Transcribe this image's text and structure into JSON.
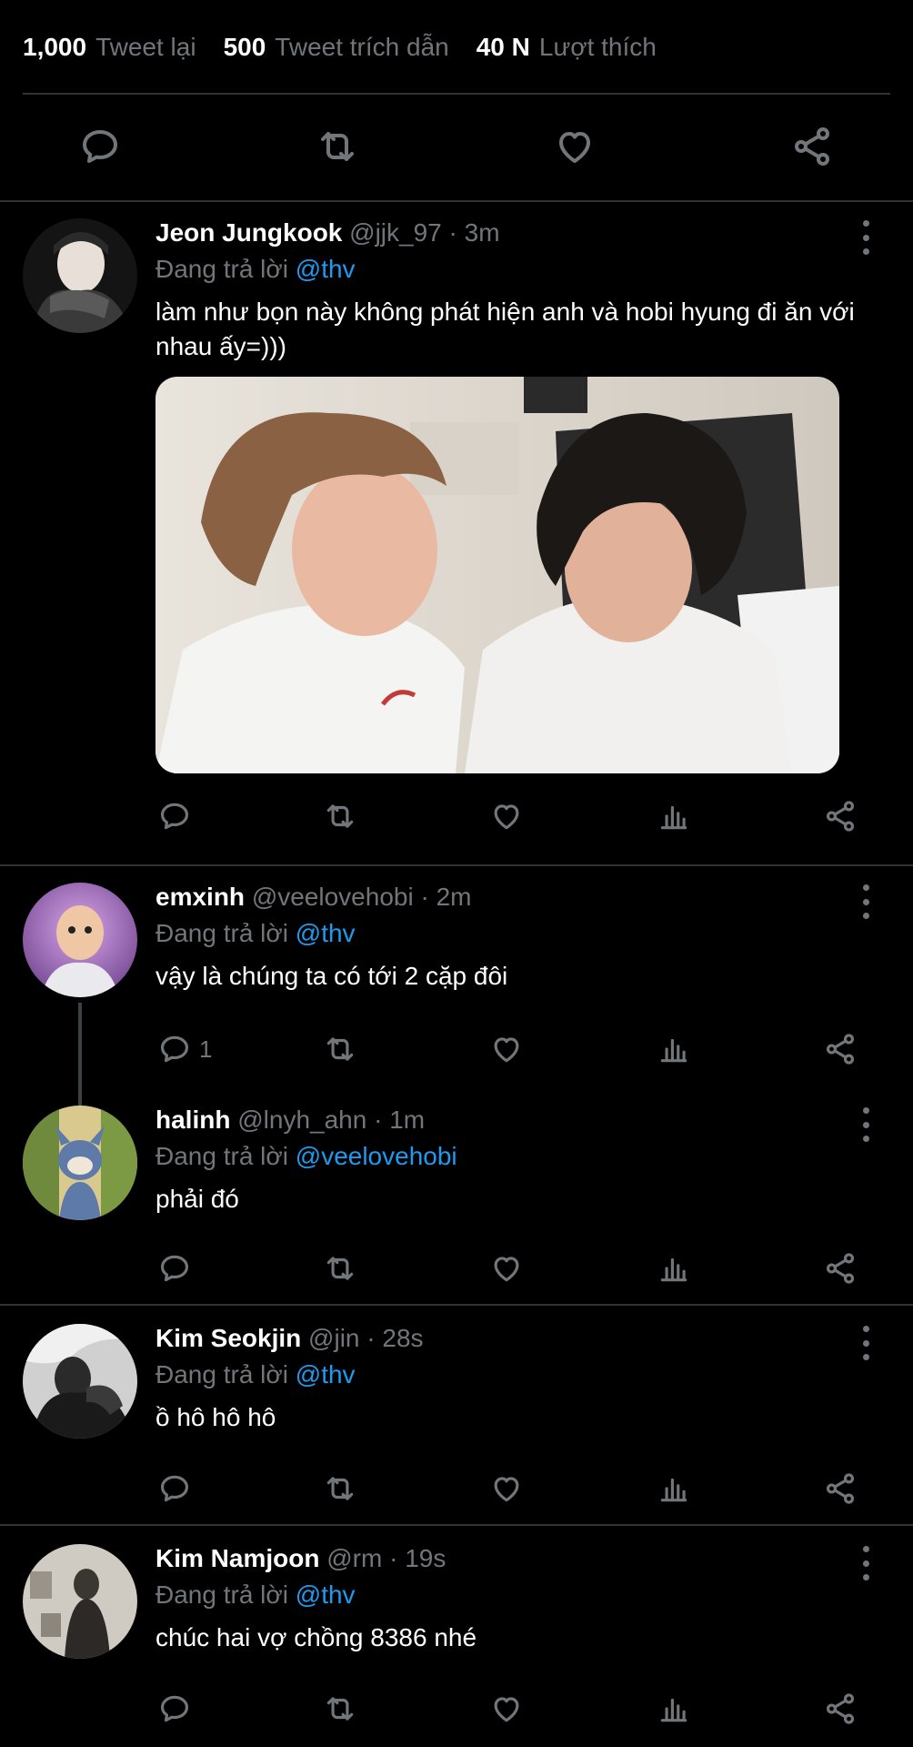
{
  "stats": [
    {
      "number": "1,000",
      "label": "Tweet lại"
    },
    {
      "number": "500",
      "label": "Tweet trích dẫn"
    },
    {
      "number": "40 N",
      "label": "Lượt thích"
    }
  ],
  "main_actions": [
    "reply-icon",
    "retweet-icon",
    "like-icon",
    "share-icon"
  ],
  "reply_prefix": "Đang trả lời",
  "tweets": [
    {
      "name": "Jeon Jungkook",
      "meta": "@jjk_97 · 3m",
      "mention": "@thv",
      "text": "làm như bọn này không phát hiện anh và hobi hyung đi ăn với nhau ấy=)))",
      "reply_count": ""
    },
    {
      "name": "emxinh",
      "meta": "@veelovehobi · 2m",
      "mention": "@thv",
      "text": "vậy là chúng ta có tới 2 cặp đôi",
      "reply_count": "1"
    },
    {
      "name": "halinh",
      "meta": "@lnyh_ahn · 1m",
      "mention": "@veelovehobi",
      "text": "phải đó",
      "reply_count": ""
    },
    {
      "name": "Kim Seokjin",
      "meta": "@jin · 28s",
      "mention": "@thv",
      "text": "ồ hô hô hô",
      "reply_count": ""
    },
    {
      "name": "Kim Namjoon",
      "meta": "@rm · 19s",
      "mention": "@thv",
      "text": "chúc hai vợ chồng 8386 nhé",
      "reply_count": ""
    }
  ],
  "row_actions": [
    "reply-icon",
    "retweet-icon",
    "like-icon",
    "analytics-icon",
    "share-icon"
  ],
  "colors": {
    "background": "#000000",
    "secondary_text": "#71767b",
    "mention": "#1d9bf0",
    "divider": "#2f3336"
  }
}
